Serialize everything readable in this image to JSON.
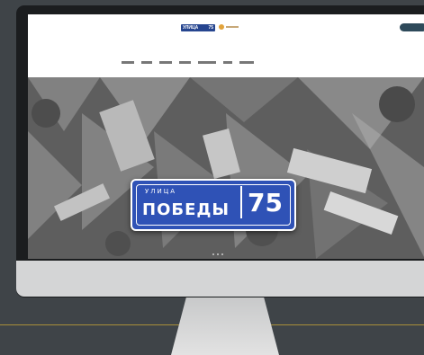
{
  "header": {
    "logo_label": "УЛИЦА",
    "logo_number": "75",
    "login_text": "",
    "cta_text": ""
  },
  "nav": {
    "items": [
      "",
      "",
      "",
      "",
      "",
      "",
      ""
    ]
  },
  "hero": {
    "sign_label": "УЛИЦА",
    "sign_name": "ПОБЕДЫ",
    "sign_number": "75"
  },
  "colors": {
    "sign_blue": "#2f52b6",
    "background": "#3f4448",
    "accent_line": "#a88f3a"
  }
}
